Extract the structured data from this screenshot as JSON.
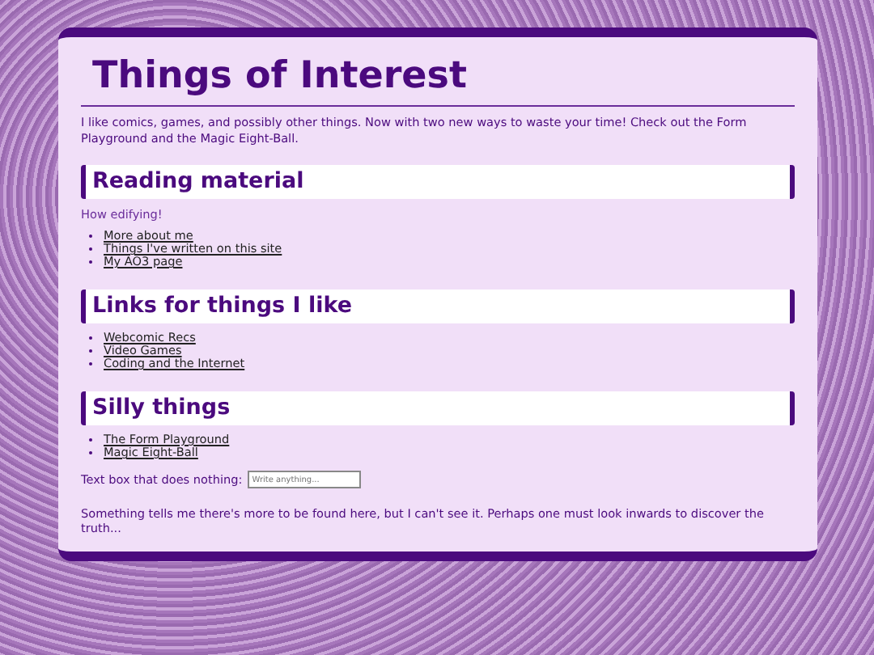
{
  "title": "Things of Interest",
  "intro": "I like comics, games, and possibly other things. Now with two new ways to waste your time! Check out the Form Playground and the Magic Eight-Ball.",
  "sections": [
    {
      "heading": "Reading material",
      "note": "How edifying!",
      "links": [
        "More about me",
        "Things I've written on this site",
        "My AO3 page"
      ]
    },
    {
      "heading": "Links for things I like",
      "links": [
        "Webcomic Recs",
        "Video Games",
        "Coding and the Internet"
      ]
    },
    {
      "heading": "Silly things",
      "links": [
        "The Form Playground",
        "Magic Eight-Ball"
      ],
      "field": {
        "label": "Text box that does nothing:",
        "placeholder": "Write anything..."
      }
    }
  ],
  "footer": "Something tells me there's more to be found here, but I can't see it. Perhaps one must look inwards to discover the truth..."
}
